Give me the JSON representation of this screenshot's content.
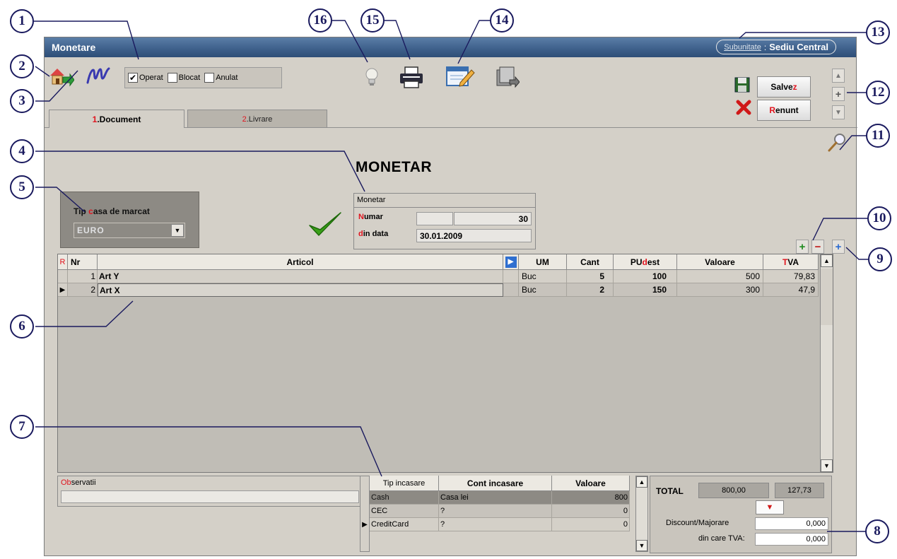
{
  "window": {
    "title": "Monetare",
    "subunit_label": "Subunitate",
    "subunit_value": "Sediu Central"
  },
  "callouts": [
    "1",
    "2",
    "3",
    "4",
    "5",
    "6",
    "7",
    "8",
    "9",
    "10",
    "11",
    "12",
    "13",
    "14",
    "15",
    "16"
  ],
  "status": {
    "operat": "Operat",
    "blocat": "Blocat",
    "anulat": "Anulat",
    "operat_checked": true
  },
  "buttons": {
    "save_prefix": "Salve",
    "save_hot": "z",
    "cancel_hot": "R",
    "cancel_rest": "enunt"
  },
  "tabs": [
    {
      "num": "1",
      "label": ".Document",
      "active": true
    },
    {
      "num": "2",
      "label": ".Livrare",
      "active": false
    }
  ],
  "heading": "MONETAR",
  "tip_casa": {
    "label_prefix": "Tip ",
    "label_hot": "c",
    "label_rest": "asa de marcat",
    "value": "EURO"
  },
  "monetar": {
    "header": "Monetar",
    "numar_hot": "N",
    "numar_rest": "umar",
    "numar_value": "30",
    "data_hot": "d",
    "data_rest": "in data",
    "data_value": "30.01.2009"
  },
  "grid": {
    "headers": {
      "r": "R",
      "nr": "Nr",
      "articol": "Articol",
      "um": "UM",
      "cant": "Cant",
      "pu_a": "PU ",
      "pu_hot": "d",
      "pu_b": "est",
      "valoare": "Valoare",
      "tva_hot": "T",
      "tva_rest": "VA"
    },
    "rows": [
      {
        "nr": "1",
        "articol": "Art Y",
        "um": "Buc",
        "cant": "5",
        "pu": "100",
        "valoare": "500",
        "tva": "79,83"
      },
      {
        "nr": "2",
        "articol": "Art X",
        "um": "Buc",
        "cant": "2",
        "pu": "150",
        "valoare": "300",
        "tva": "47,9"
      }
    ]
  },
  "observatii": {
    "hot": "Ob",
    "rest": "servatii"
  },
  "payments": {
    "headers": {
      "tip": "Tip incasare",
      "cont": "Cont incasare",
      "valoare": "Valoare"
    },
    "rows": [
      {
        "tip": "Cash",
        "cont": "Casa lei",
        "valoare": "800"
      },
      {
        "tip": "CEC",
        "cont": "?",
        "valoare": "0"
      },
      {
        "tip": "CreditCard",
        "cont": "?",
        "valoare": "0"
      }
    ]
  },
  "totals": {
    "label": "TOTAL",
    "value": "800,00",
    "tva": "127,73",
    "discount_label": "Discount/Majorare",
    "discount_value": "0,000",
    "tva_label": "din care TVA:",
    "tva_value": "0,000"
  },
  "colors": {
    "titlebar": "#3d5f8a",
    "accent_red": "#e0141e",
    "callout": "#1a1a5e"
  }
}
